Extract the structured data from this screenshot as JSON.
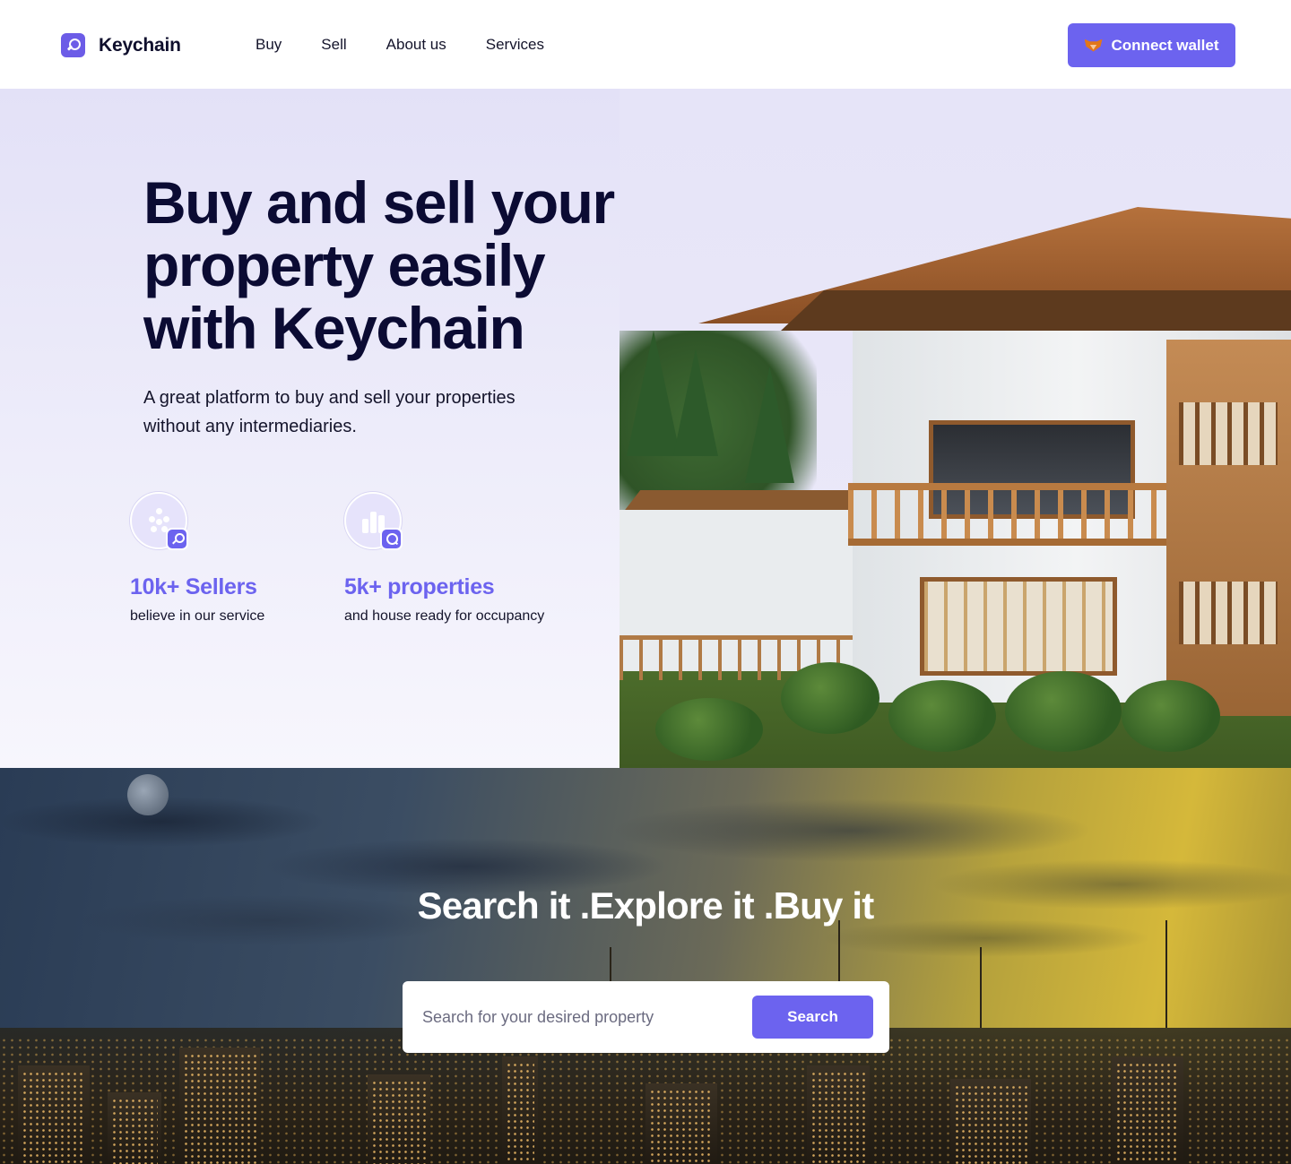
{
  "nav": {
    "brand": "Keychain",
    "items": [
      {
        "label": "Buy"
      },
      {
        "label": "Sell"
      },
      {
        "label": "About us"
      },
      {
        "label": "Services"
      }
    ],
    "wallet_button": "Connect wallet"
  },
  "hero": {
    "title": "Buy and  sell your property easily with Keychain",
    "subtitle": "A great platform to buy and  sell  your properties without any intermediaries.",
    "stats": [
      {
        "value": "10k+ Sellers",
        "label": "believe in our service",
        "icon": "sellers-icon",
        "badge_icon": "key-icon"
      },
      {
        "value": "5k+ properties",
        "label": "and house ready for occupancy",
        "icon": "buildings-icon",
        "badge_icon": "search-icon"
      }
    ]
  },
  "search": {
    "title": "Search it .Explore it .Buy it",
    "placeholder": "Search for your desired property",
    "button": "Search"
  },
  "colors": {
    "accent": "#6c63ef",
    "heading": "#0b0b33",
    "hero_bg": "#e3e1f7"
  }
}
